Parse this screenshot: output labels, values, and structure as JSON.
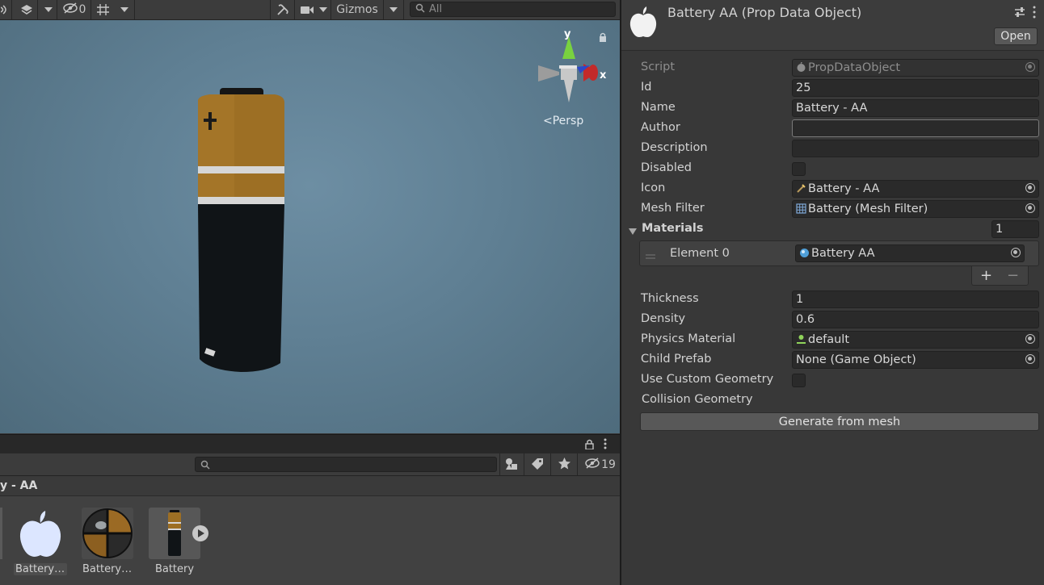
{
  "scene": {
    "toolbar": {
      "hidden_count": "0",
      "gizmos_label": "Gizmos",
      "search_placeholder": "All"
    },
    "gizmo": {
      "y_label": "y",
      "x_label": "x",
      "projection_label": "Persp"
    }
  },
  "project": {
    "search_placeholder": "",
    "hidden_count": "19",
    "breadcrumb": "y - AA",
    "assets": [
      {
        "label": "Battery ...",
        "icon": "apple-icon",
        "selected": true
      },
      {
        "label": "Battery ...",
        "icon": "material-sphere-icon",
        "selected": false
      },
      {
        "label": "Battery",
        "icon": "battery-model-icon",
        "selected": false
      }
    ]
  },
  "inspector": {
    "title": "Battery AA (Prop Data Object)",
    "open_label": "Open",
    "icon": "apple-icon",
    "fields": {
      "script": {
        "label": "Script",
        "value": "PropDataObject"
      },
      "id": {
        "label": "Id",
        "value": "25"
      },
      "name": {
        "label": "Name",
        "value": "Battery - AA"
      },
      "author": {
        "label": "Author",
        "value": ""
      },
      "description": {
        "label": "Description",
        "value": ""
      },
      "disabled": {
        "label": "Disabled",
        "checked": false
      },
      "icon": {
        "label": "Icon",
        "value": "Battery - AA"
      },
      "mesh_filter": {
        "label": "Mesh Filter",
        "value": "Battery (Mesh Filter)"
      },
      "materials": {
        "label": "Materials",
        "size": "1",
        "elements": [
          {
            "label": "Element 0",
            "value": "Battery AA"
          }
        ]
      },
      "thickness": {
        "label": "Thickness",
        "value": "1"
      },
      "density": {
        "label": "Density",
        "value": "0.6"
      },
      "physics_material": {
        "label": "Physics Material",
        "value": "default"
      },
      "child_prefab": {
        "label": "Child Prefab",
        "value": "None (Game Object)"
      },
      "use_custom_geometry": {
        "label": "Use Custom Geometry",
        "checked": false
      },
      "collision_geometry": {
        "label": "Collision Geometry"
      }
    },
    "generate_label": "Generate from mesh",
    "list_add": "+",
    "list_remove": "−"
  }
}
